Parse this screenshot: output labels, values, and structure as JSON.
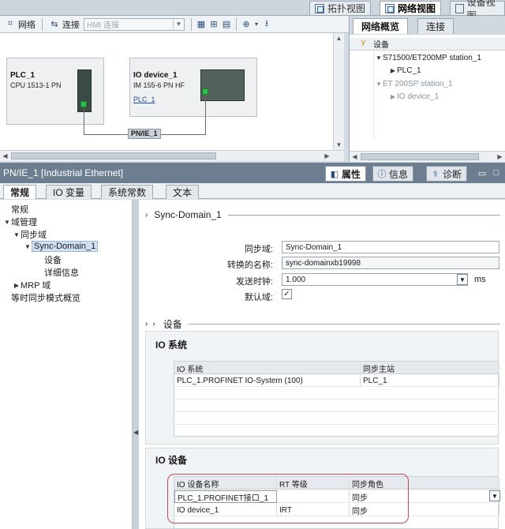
{
  "top_tabs": [
    "拓扑视图",
    "网络视图",
    "设备视图"
  ],
  "toolbar": {
    "network_label": "网络",
    "connect_label": "连接",
    "hmi_select_value": "HMI 连接"
  },
  "canvas": {
    "plc": {
      "name": "PLC_1",
      "model": "CPU 1513-1 PN"
    },
    "io_device": {
      "name": "IO device_1",
      "model": "IM 155-6 PN HF",
      "link": "PLC_1"
    },
    "subnet_label": "PN/IE_1"
  },
  "overview": {
    "tabs": [
      "网络概览",
      "连接"
    ],
    "header": "设备",
    "rows": [
      {
        "label": "S71500/ET200MP station_1",
        "gray": false
      },
      {
        "label": "PLC_1",
        "gray": false
      },
      {
        "label": "ET 200SP station_1",
        "gray": true
      },
      {
        "label": "IO device_1",
        "gray": true
      }
    ]
  },
  "properties": {
    "title": "PN/IE_1 [Industrial Ethernet]",
    "tabs": [
      "属性",
      "信息",
      "诊断"
    ]
  },
  "sub_tabs": [
    "常规",
    "IO 变量",
    "系统常数",
    "文本"
  ],
  "tree": [
    "常规",
    "域管理",
    "同步域",
    "Sync-Domain_1",
    "设备",
    "详细信息",
    "MRP 域",
    "等时同步模式概览"
  ],
  "detail": {
    "section_title": "Sync-Domain_1",
    "form": {
      "sync_domain_label": "同步域:",
      "sync_domain_value": "Sync-Domain_1",
      "converted_name_label": "转换的名称:",
      "converted_name_value": "sync-domainxb19998",
      "send_clock_label": "发送时钟:",
      "send_clock_value": "1.000",
      "send_clock_unit": "ms",
      "default_domain_label": "默认域:",
      "default_checked": "✓"
    },
    "devices_section": "设备",
    "io_system": {
      "title": "IO 系统",
      "headers": [
        "IO 系统",
        "同步主站"
      ],
      "rows": [
        [
          "PLC_1.PROFINET IO-System (100)",
          "PLC_1"
        ]
      ]
    },
    "io_devices": {
      "title": "IO 设备",
      "headers": [
        "IO 设备名称",
        "RT 等级",
        "同步角色"
      ],
      "rows": [
        [
          "PLC_1.PROFINET接口_1",
          "",
          "同步"
        ],
        [
          "IO device_1",
          "IRT",
          "同步"
        ]
      ]
    }
  }
}
